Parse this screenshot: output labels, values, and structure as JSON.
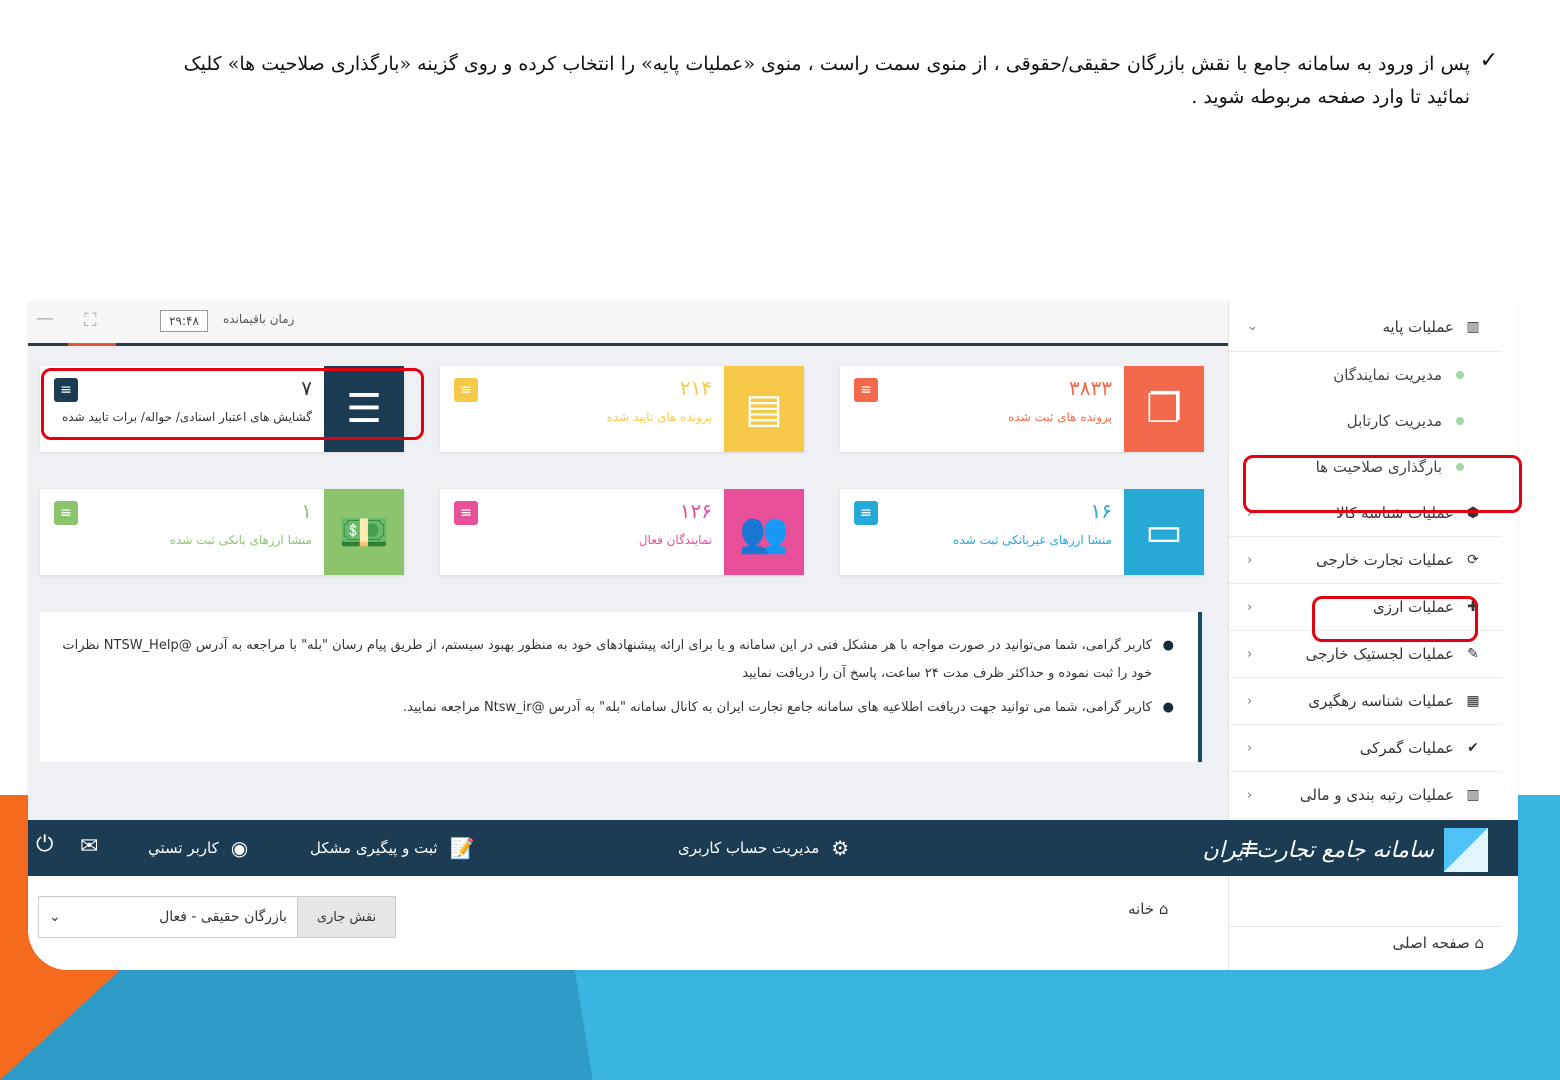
{
  "instruction": {
    "line1": "پس از ورود به سامانه جامع با نقش بازرگان حقیقی/حقوقی ، از منوی سمت راست ، منوی «عملیات پایه» را انتخاب کرده و روی گزینه «بارگذاری صلاحیت ها» کلیک",
    "line2": "نمائید تا وارد صفحه مربوطه شوید ."
  },
  "topbar": {
    "timer_label": "زمان باقیمانده",
    "timer_value": "۲۹:۴۸"
  },
  "cards": [
    {
      "value": "۳۸۳۳",
      "label": "پرونده های ثبت شده",
      "color": "#f26a4b",
      "icon": "files-icon"
    },
    {
      "value": "۲۱۴",
      "label": "پرونده های تایید شده",
      "color": "#f7c948",
      "icon": "document-icon"
    },
    {
      "value": "۷",
      "label": "گشایش های اعتبار اسنادی/ حواله/ برات تایید شده",
      "color": "#1b3c52",
      "icon": "list-icon"
    },
    {
      "value": "۱۶",
      "label": "منشا ارزهای غیربانکی ثبت شده",
      "color": "#27a9d6",
      "icon": "card-icon"
    },
    {
      "value": "۱۲۶",
      "label": "نمایندگان فعال",
      "color": "#e8509a",
      "icon": "users-icon"
    },
    {
      "value": "۱",
      "label": "منشا ارزهای بانکی ثبت شده",
      "color": "#8cc46e",
      "icon": "money-icon"
    }
  ],
  "notices": [
    "کاربر گرامی، شما می‌توانید در صورت مواجه با هر مشکل فنی در این سامانه و یا برای ارائه پیشنهادهای خود به منظور بهبود سیستم، از طریق پیام رسان \"بله\" با مراجعه به آدرس @NTSW_Help نظرات خود را ثبت نموده و حداکثر ظرف مدت ۲۴ ساعت، پاسخ آن را دریافت نمایید",
    "کاربر گرامی، شما می توانید جهت دریافت اطلاعیه های سامانه جامع تجارت ایران به کانال سامانه \"بله\" به آدرس @Ntsw_ir مراجعه نمایید."
  ],
  "sidebar": {
    "header": "عملیات پایه",
    "subitems": [
      "مدیریت نمایندگان",
      "مدیریت کارتابل",
      "بارگذاری صلاحیت ها"
    ],
    "items": [
      "عملیات شناسه کالا",
      "عملیات تجارت خارجی",
      "عملیات ارزی",
      "عملیات لجستیک خارجی",
      "عملیات شناسه رهگیری",
      "عملیات گمرکی",
      "عملیات رتبه بندی و مالی"
    ],
    "home": "صفحه اصلی"
  },
  "navbar": {
    "logo": "سامانه جامع تجارت ایران",
    "account": "مدیریت حساب کاربری",
    "issues": "ثبت و پیگیری مشکل",
    "user": "کاربر تستي"
  },
  "breadcrumb": "خانه",
  "role": {
    "label": "نقش جاری",
    "value": "بازرگان حقیقی - فعال"
  }
}
